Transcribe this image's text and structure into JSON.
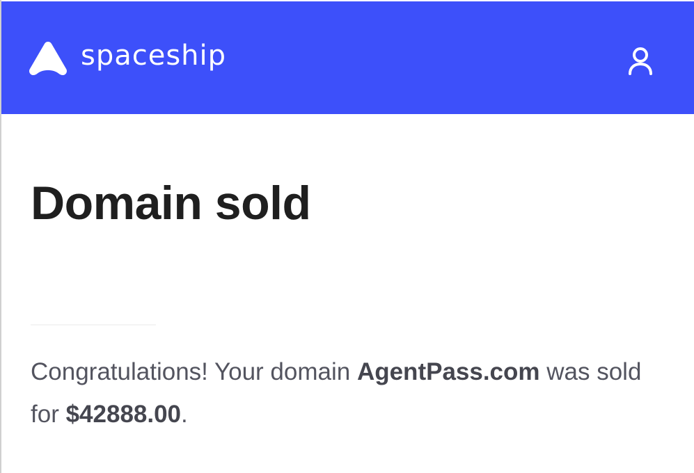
{
  "header": {
    "brand_name": "spaceship",
    "logo_icon": "spaceship-logo-icon",
    "account_icon": "user-icon",
    "background_color": "#3d50fa",
    "foreground_color": "#ffffff"
  },
  "main": {
    "title": "Domain sold",
    "message": {
      "prefix": "Congratulations! Your domain ",
      "domain": "AgentPass.com",
      "middle": " was sold for ",
      "price": "$42888.00",
      "suffix": "."
    },
    "title_color": "#1f1f1f",
    "text_color": "#53545f"
  }
}
